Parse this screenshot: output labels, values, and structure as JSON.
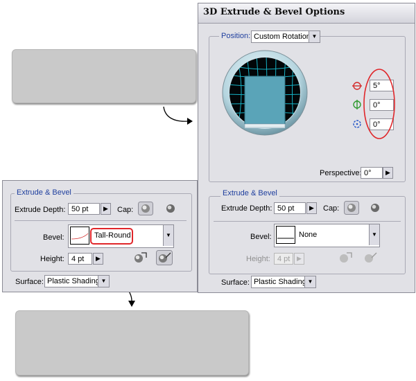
{
  "dialog": {
    "title": "3D Extrude & Bevel Options",
    "position_label": "Position:",
    "position_value": "Custom Rotation",
    "rotation": {
      "x": "5°",
      "y": "0°",
      "z": "0°"
    },
    "perspective_label": "Perspective:",
    "perspective_value": "0°",
    "extrude_bevel_legend": "Extrude & Bevel",
    "extrude_depth_label": "Extrude Depth:",
    "extrude_depth_value": "50 pt",
    "cap_label": "Cap:",
    "bevel_label": "Bevel:",
    "bevel_value": "None",
    "height_label": "Height:",
    "height_value": "4 pt",
    "surface_label": "Surface:",
    "surface_value": "Plastic Shading"
  },
  "excerpt": {
    "extrude_bevel_legend": "Extrude & Bevel",
    "extrude_depth_label": "Extrude Depth:",
    "extrude_depth_value": "50 pt",
    "cap_label": "Cap:",
    "bevel_label": "Bevel:",
    "bevel_value": "Tall-Round",
    "height_label": "Height:",
    "height_value": "4 pt",
    "surface_label": "Surface:",
    "surface_value": "Plastic Shading"
  },
  "colors": {
    "annotation_red": "#e0262a",
    "cube_face": "#5aa4b8",
    "grid_line": "#16b3c6",
    "legend_blue": "#1f3f9e"
  },
  "icons": [
    "rotate-x-icon",
    "rotate-y-icon",
    "rotate-z-icon",
    "cap-on-icon",
    "cap-off-icon",
    "bevel-out-icon",
    "bevel-in-icon",
    "arrow-right-icon",
    "arrow-down-icon"
  ]
}
